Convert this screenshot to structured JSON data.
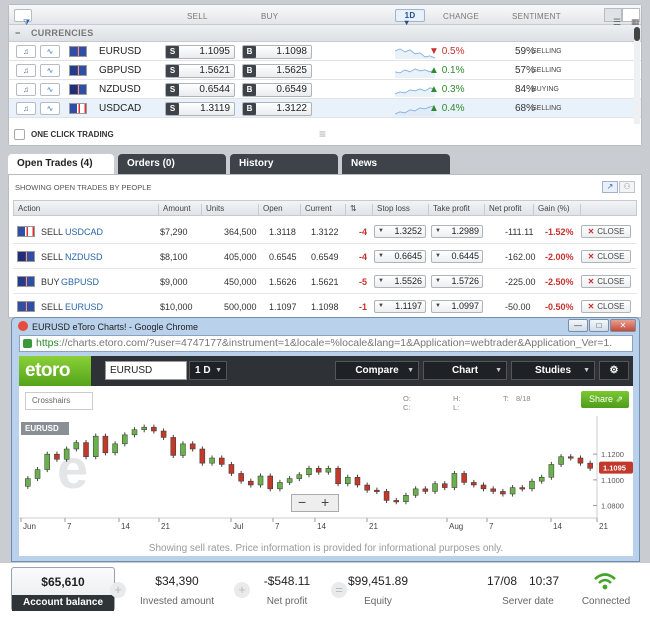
{
  "markets": {
    "headers": {
      "sell": "SELL",
      "buy": "BUY",
      "period": "1D",
      "change": "CHANGE",
      "sentiment": "SENTIMENT"
    },
    "section": "CURRENCIES",
    "rows": [
      {
        "symbol": "EURUSD",
        "sell": "1.1095",
        "buy": "1.1098",
        "change": "0.5%",
        "direction": "down",
        "sentiment_pct": "59%",
        "sentiment": "SELLING"
      },
      {
        "symbol": "GBPUSD",
        "sell": "1.5621",
        "buy": "1.5625",
        "change": "0.1%",
        "direction": "up",
        "sentiment_pct": "57%",
        "sentiment": "SELLING"
      },
      {
        "symbol": "NZDUSD",
        "sell": "0.6544",
        "buy": "0.6549",
        "change": "0.3%",
        "direction": "up",
        "sentiment_pct": "84%",
        "sentiment": "BUYING"
      },
      {
        "symbol": "USDCAD",
        "sell": "1.3119",
        "buy": "1.3122",
        "change": "0.4%",
        "direction": "up",
        "sentiment_pct": "68%",
        "sentiment": "SELLING"
      }
    ],
    "sell_badge": "S",
    "buy_badge": "B",
    "one_click": "ONE CLICK TRADING"
  },
  "tabs": [
    "Open Trades (4)",
    "Orders (0)",
    "History",
    "News"
  ],
  "trades": {
    "subtitle": "SHOWING OPEN TRADES BY PEOPLE",
    "columns": [
      "Action",
      "Amount",
      "Units",
      "Open",
      "Current",
      "",
      "Stop loss",
      "Take profit",
      "Net profit",
      "Gain (%)"
    ],
    "close_label": "CLOSE",
    "rows": [
      {
        "action": "SELL",
        "symbol": "USDCAD",
        "amount": "$7,290",
        "units": "364,500",
        "open": "1.3118",
        "current": "1.3122",
        "pips": "-4",
        "stop": "1.3252",
        "take": "1.2989",
        "net": "-111.11",
        "gain": "-1.52%"
      },
      {
        "action": "SELL",
        "symbol": "NZDUSD",
        "amount": "$8,100",
        "units": "405,000",
        "open": "0.6545",
        "current": "0.6549",
        "pips": "-4",
        "stop": "0.6645",
        "take": "0.6445",
        "net": "-162.00",
        "gain": "-2.00%"
      },
      {
        "action": "BUY",
        "symbol": "GBPUSD",
        "amount": "$9,000",
        "units": "450,000",
        "open": "1.5626",
        "current": "1.5621",
        "pips": "-5",
        "stop": "1.5526",
        "take": "1.5726",
        "net": "-225.00",
        "gain": "-2.50%"
      },
      {
        "action": "SELL",
        "symbol": "EURUSD",
        "amount": "$10,000",
        "units": "500,000",
        "open": "1.1097",
        "current": "1.1098",
        "pips": "-1",
        "stop": "1.1197",
        "take": "1.0997",
        "net": "-50.00",
        "gain": "-0.50%"
      }
    ]
  },
  "popup": {
    "title": "EURUSD eToro Charts! - Google Chrome",
    "url_secure": "https",
    "url_rest": "://charts.etoro.com/?user=4747177&instrument=1&locale=%locale&lang=1&Application=webtrader&Application_Ver=1.",
    "logo": "etoro",
    "instrument": "EURUSD",
    "period": "1 D",
    "menus": [
      "Compare",
      "Chart",
      "Studies"
    ],
    "crosshairs": "Crosshairs",
    "share": "Share",
    "ohlc": {
      "O": "O:",
      "C": "C:",
      "H": "H:",
      "L": "L:",
      "T": "T:",
      "T_value": "8/18"
    },
    "tag": "EURUSD",
    "disclaimer": "Showing sell rates. Price information is provided for informational purposes only."
  },
  "chart_data": {
    "type": "candlestick",
    "instrument": "EURUSD",
    "y_ticks": [
      "1.1200",
      "1.1000",
      "1.0800"
    ],
    "current_price": "1.1095",
    "x_ticks": [
      "Jun",
      "7",
      "14",
      "21",
      "Jul",
      "7",
      "14",
      "21",
      "Aug",
      "7",
      "14",
      "21"
    ],
    "closes": [
      1.101,
      1.108,
      1.12,
      1.116,
      1.124,
      1.129,
      1.118,
      1.134,
      1.121,
      1.128,
      1.135,
      1.139,
      1.141,
      1.138,
      1.133,
      1.119,
      1.128,
      1.124,
      1.113,
      1.117,
      1.112,
      1.105,
      1.099,
      1.096,
      1.103,
      1.093,
      1.098,
      1.101,
      1.104,
      1.109,
      1.106,
      1.109,
      1.097,
      1.102,
      1.096,
      1.092,
      1.091,
      1.084,
      1.083,
      1.088,
      1.093,
      1.091,
      1.097,
      1.094,
      1.105,
      1.098,
      1.096,
      1.093,
      1.091,
      1.089,
      1.094,
      1.093,
      1.099,
      1.102,
      1.112,
      1.118,
      1.117,
      1.113,
      1.109
    ]
  },
  "account": {
    "balance": "$65,610",
    "balance_label": "Account balance",
    "invested": "$34,390",
    "invested_label": "Invested amount",
    "net_profit": "-$548.11",
    "net_profit_label": "Net profit",
    "equity": "$99,451.89",
    "equity_label": "Equity",
    "date": "17/08",
    "time": "10:37",
    "server_label": "Server date",
    "connected": "Connected"
  },
  "colors": {
    "up": "#2e8b2e",
    "down": "#c8302c",
    "candle_up": "#6ab04c",
    "candle_down": "#c0392b",
    "accent": "#55a31b"
  }
}
